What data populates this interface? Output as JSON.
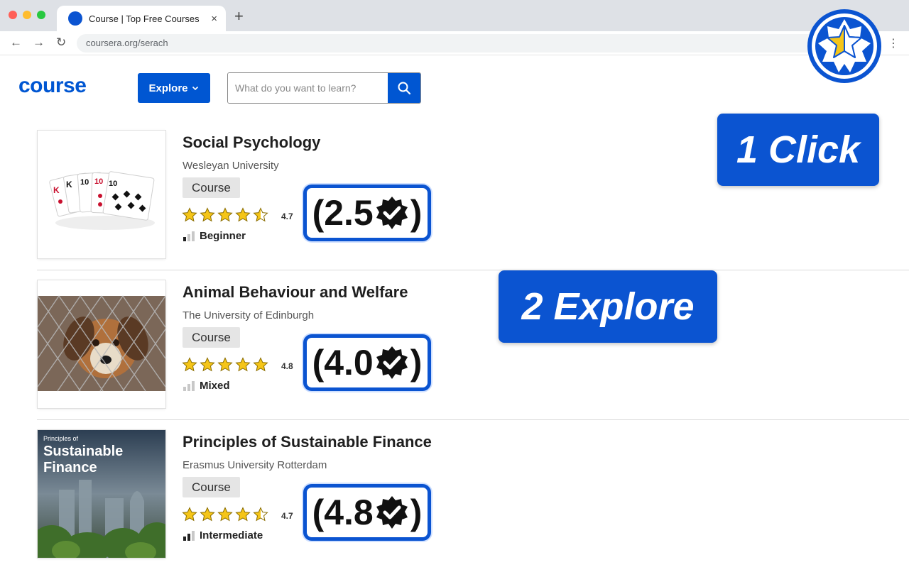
{
  "browser": {
    "tab_title": "Course | Top Free Courses",
    "tab_close": "×",
    "new_tab": "+",
    "url": "coursera.org/serach",
    "back": "←",
    "forward": "→",
    "reload": "↻",
    "menu": "⋮"
  },
  "header": {
    "logo": "course",
    "explore_label": "Explore",
    "search_placeholder": "What do you want to learn?"
  },
  "callouts": {
    "step1": "1 Click",
    "step2": "2 Explore"
  },
  "courses": [
    {
      "title": "Social Psychology",
      "partner": "Wesleyan University",
      "type": "Course",
      "rating": "4.7",
      "stars": 4.5,
      "level": "Beginner",
      "level_bars": 1,
      "score_open": "(",
      "score_value": "2.5",
      "score_close": ")",
      "thumb_icon": "playing-cards-image"
    },
    {
      "title": "Animal Behaviour and Welfare",
      "partner": "The University of Edinburgh",
      "type": "Course",
      "rating": "4.8",
      "stars": 5,
      "level": "Mixed",
      "level_bars": 0,
      "score_open": "(",
      "score_value": "4.0",
      "score_close": ")",
      "thumb_icon": "dog-behind-fence-image"
    },
    {
      "title": "Principles of Sustainable Finance",
      "partner": "Erasmus University Rotterdam",
      "type": "Course",
      "rating": "4.7",
      "stars": 4.5,
      "level": "Intermediate",
      "level_bars": 2,
      "score_open": "(",
      "score_value": "4.8",
      "score_close": ")",
      "thumb_icon": "sustainable-finance-cover",
      "thumb_small": "Principles of",
      "thumb_big1": "Sustainable",
      "thumb_big2": "Finance"
    }
  ],
  "colors": {
    "brand": "#0056d2",
    "callout": "#0b54d1",
    "star": "#f5c518"
  }
}
